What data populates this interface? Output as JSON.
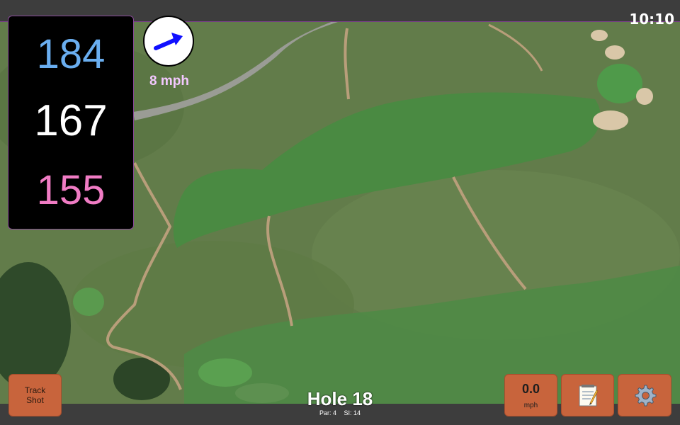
{
  "status": {
    "time": "10:10"
  },
  "distances": {
    "back": "184",
    "middle": "167",
    "front": "155"
  },
  "wind": {
    "speed": "8 mph",
    "arrow_icon": "wind-direction-arrow-icon"
  },
  "hole": {
    "title": "Hole 18",
    "par": "Par: 4",
    "stroke_index": "SI: 14"
  },
  "buttons": {
    "track_shot_line1": "Track",
    "track_shot_line2": "Shot",
    "speed_value": "0.0",
    "speed_unit": "mph",
    "notes_icon": "notepad-icon",
    "settings_icon": "gear-icon"
  },
  "colors": {
    "back_distance": "#6aaef0",
    "middle_distance": "#ffffff",
    "front_distance": "#f07cc4",
    "button": "#c8643c",
    "wind_label": "#f3c8ff"
  }
}
